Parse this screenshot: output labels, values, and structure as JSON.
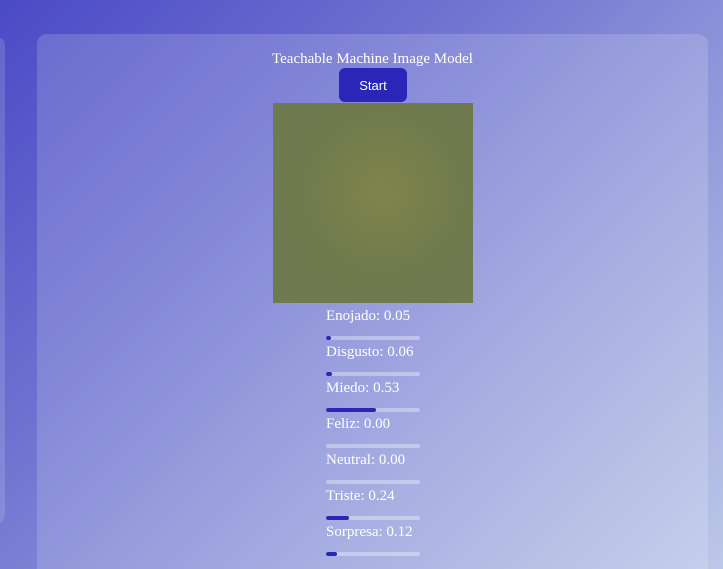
{
  "app": {
    "title": "Teachable Machine Image Model",
    "start_label": "Start"
  },
  "colors": {
    "accent": "#2b25b8",
    "text": "#ffffff"
  },
  "predictions": [
    {
      "label": "Enojado: 0.05",
      "value": 0.05
    },
    {
      "label": "Disgusto: 0.06",
      "value": 0.06
    },
    {
      "label": "Miedo: 0.53",
      "value": 0.53
    },
    {
      "label": "Feliz: 0.00",
      "value": 0.0
    },
    {
      "label": "Neutral: 0.00",
      "value": 0.0
    },
    {
      "label": "Triste: 0.24",
      "value": 0.24
    },
    {
      "label": "Sorpresa: 0.12",
      "value": 0.12
    }
  ]
}
